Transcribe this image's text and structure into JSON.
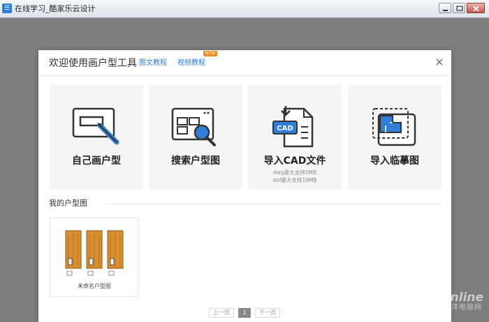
{
  "window": {
    "title": "在线学习_酷家乐云设计",
    "app_icon": "app-logo-icon",
    "controls": [
      "minimize-icon",
      "restore-icon",
      "close-icon"
    ]
  },
  "dialog": {
    "title": "欢迎使用画户型工具",
    "links": [
      {
        "label": "图文教程"
      },
      {
        "label": "视频教程",
        "badge": "NEW"
      }
    ],
    "close_icon": "close-icon",
    "accent_color": "#2f7fd8",
    "options": [
      {
        "label": "自己画户型",
        "icon": "draw-floorplan-icon"
      },
      {
        "label": "搜索户型图",
        "icon": "search-floorplan-icon"
      },
      {
        "label": "导入CAD文件",
        "icon": "import-cad-icon",
        "icon_text": "CAD",
        "notes": [
          "dwg最大支持5MB",
          "dxf最大支持10MB"
        ]
      },
      {
        "label": "导入临摹图",
        "icon": "import-trace-icon"
      }
    ],
    "my_plans": {
      "title": "我的户型图",
      "items": [
        {
          "name": "未命名户型图"
        }
      ]
    },
    "pagination": {
      "prev": "上一页",
      "current": "1",
      "next": "下一页"
    }
  },
  "watermark": {
    "text": "PConline",
    "sub": "太平洋电脑网"
  }
}
